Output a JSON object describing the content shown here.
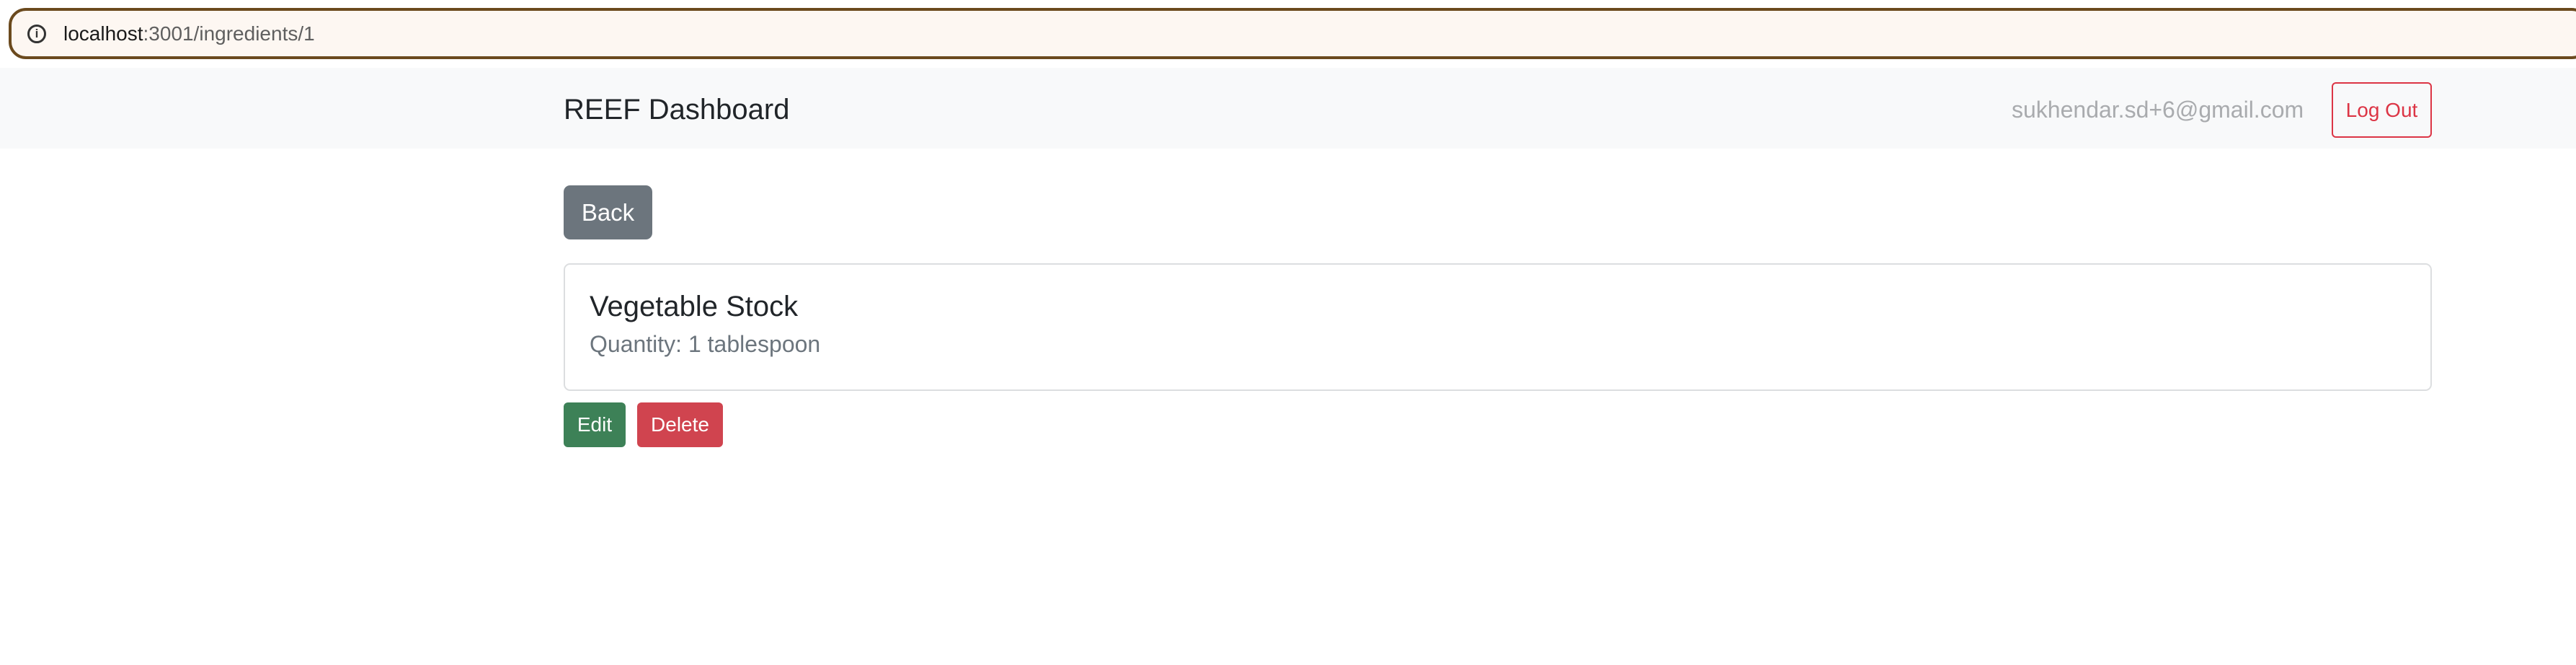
{
  "browser": {
    "url_host": "localhost",
    "url_rest": ":3001/ingredients/1",
    "info_icon": "info-icon"
  },
  "navbar": {
    "brand": "REEF Dashboard",
    "user_email": "sukhendar.sd+6@gmail.com",
    "logout_label": "Log Out"
  },
  "main": {
    "back_label": "Back",
    "ingredient": {
      "name": "Vegetable Stock",
      "quantity_text": "Quantity: 1 tablespoon"
    },
    "edit_label": "Edit",
    "delete_label": "Delete"
  },
  "colors": {
    "secondary": "#6c757d",
    "success": "#3d8157",
    "danger": "#dc3545",
    "navbar_bg": "#f8f9fa"
  }
}
